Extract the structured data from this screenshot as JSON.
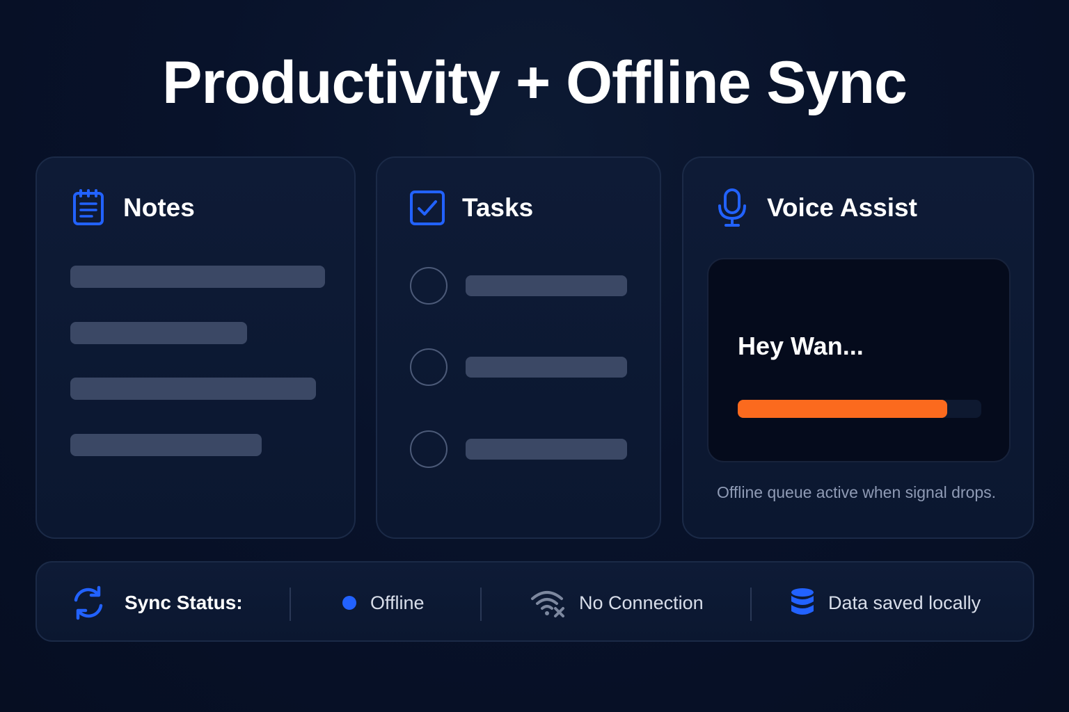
{
  "title": "Productivity + Offline Sync",
  "colors": {
    "accent_blue": "#2262ff",
    "progress_orange": "#fb6a1e",
    "background": "#08122a"
  },
  "notes": {
    "label": "Notes",
    "icon": "notepad-icon"
  },
  "tasks": {
    "label": "Tasks",
    "icon": "checkbox-icon"
  },
  "voice": {
    "label": "Voice Assist",
    "icon": "microphone-icon",
    "transcript": "Hey Wan...",
    "progress": 0.86,
    "caption": "Offline queue active when signal drops."
  },
  "status_bar": {
    "title": "Sync Status:",
    "title_icon": "sync-icon",
    "state": "Offline",
    "state_icon": "status-dot-icon",
    "connection": "No Connection",
    "connection_icon": "wifi-off-icon",
    "storage": "Data saved locally",
    "storage_icon": "database-icon"
  }
}
